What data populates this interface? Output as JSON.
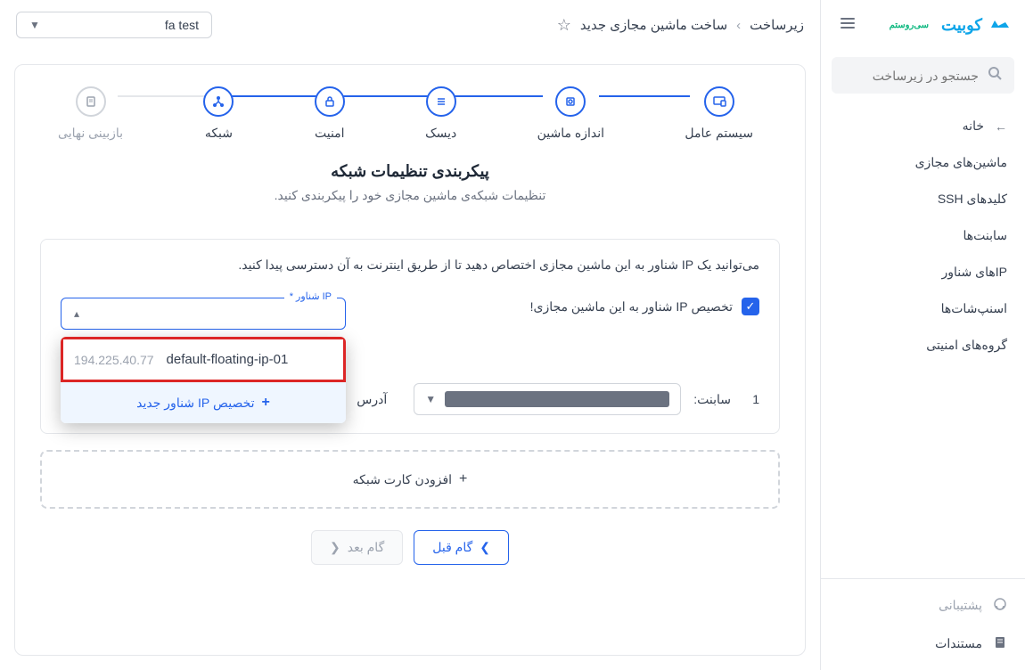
{
  "brand": {
    "name": "کوبیت",
    "sub": "سی‌روستم"
  },
  "search": {
    "placeholder": "جستجو در زیرساخت"
  },
  "nav": {
    "home": "خانه",
    "vms": "ماشین‌های مجازی",
    "ssh": "کلیدهای SSH",
    "subnets": "سابنت‌ها",
    "floating": "IPهای شناور",
    "snapshots": "اسنپ‌شات‌ها",
    "secgroups": "گروه‌های امنیتی",
    "support": "پشتیبانی",
    "docs": "مستندات"
  },
  "breadcrumb": {
    "parent": "زیرساخت",
    "current": "ساخت ماشین مجازی جدید"
  },
  "project": {
    "name": "fa test"
  },
  "stepper": {
    "s1": "سیستم عامل",
    "s2": "اندازه ماشین",
    "s3": "دیسک",
    "s4": "امنیت",
    "s5": "شبکه",
    "s6": "بازبینی نهایی"
  },
  "page": {
    "title": "پیکربندی تنظیمات شبکه",
    "desc": "تنظیمات شبکه‌ی ماشین مجازی خود را پیکربندی کنید."
  },
  "panel": {
    "desc": "می‌توانید یک IP شناور به این ماشین مجازی اختصاص دهید تا از طریق اینترنت به آن دسترسی پیدا کنید.",
    "checkbox": "تخصیص IP شناور به این ماشین مجازی!",
    "ip_select_label": "IP شناور *",
    "dropdown": {
      "ip_addr": "194.225.40.77",
      "ip_name": "default-floating-ip-01",
      "action": "تخصیص IP شناور جدید"
    },
    "subnet": {
      "num": "1",
      "label": "سابنت:",
      "addr_label": "آدرس"
    }
  },
  "add_card": "افزودن کارت شبکه",
  "footer": {
    "prev": "گام قبل",
    "next": "گام بعد"
  }
}
